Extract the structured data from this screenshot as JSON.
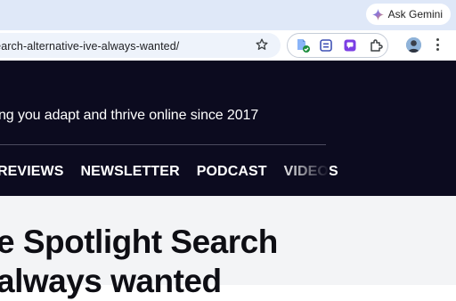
{
  "browser": {
    "ask_gemini_label": "Ask Gemini",
    "url": "t-search-alternative-ive-always-wanted/",
    "extensions": [
      "extension-doc-icon",
      "extension-notes-icon",
      "extension-chat-icon",
      "puzzle-icon"
    ],
    "colors": {
      "top_strip": "#dfe8f8",
      "omnibox": "#eef3fb"
    }
  },
  "site": {
    "tagline": "ng you adapt and thrive online since 2017",
    "nav": [
      "REVIEWS",
      "NEWSLETTER",
      "PODCAST",
      "VIDEOS"
    ],
    "colors": {
      "header_bg": "#0c0b1f",
      "text": "#ffffff"
    }
  },
  "article": {
    "headline_line1": "e Spotlight Search",
    "headline_line2": "always wanted"
  }
}
